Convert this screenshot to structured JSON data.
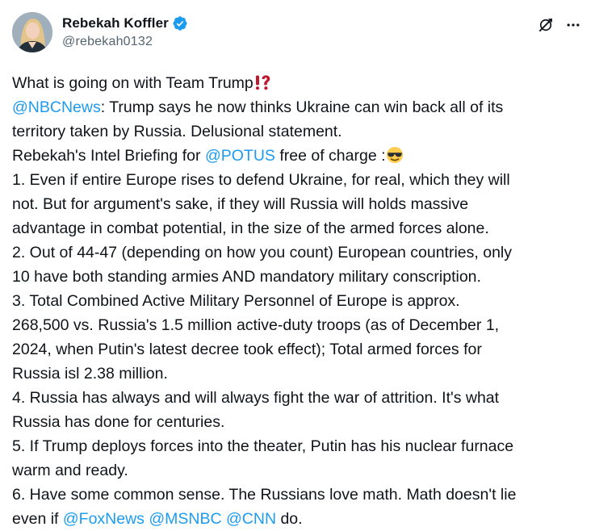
{
  "author": {
    "display_name": "Rebekah Koffler",
    "handle": "@rebekah0132",
    "verified": true
  },
  "icons": {
    "verified": "verified-badge-icon",
    "grok": "grok-icon",
    "more": "more-options-icon",
    "exclamation": "exclamation-question-mark-emoji",
    "sunglasses": "smiling-face-with-sunglasses-emoji"
  },
  "colors": {
    "link": "#1d9bf0",
    "text": "#0f1419",
    "secondary": "#536471"
  },
  "tweet": {
    "l1": "What is going on with Team Trump",
    "l2_mention": "@NBCNews",
    "l2_text": ": Trump says he now thinks Ukraine can win back all of its",
    "l3": "territory taken by Russia. Delusional statement.",
    "l4_pre": "Rebekah's Intel Briefing for ",
    "l4_mention": "@POTUS",
    "l4_post": " free of charge :",
    "l5": "1. Even if entire Europe rises to defend Ukraine, for real, which they will",
    "l6": "not. But for argument's sake, if they will Russia will holds massive",
    "l7": "advantage in combat potential, in the size of the armed forces alone.",
    "l8": "2. Out of 44-47 (depending on how you count) European countries, only",
    "l9": "10 have both standing armies AND mandatory military conscription.",
    "l10": "3. Total Combined Active Military Personnel of Europe is approx.",
    "l11": "268,500 vs. Russia's 1.5 million active-duty troops (as of December 1,",
    "l12": "2024, when Putin's latest decree took effect); Total armed forces for",
    "l13": "Russia isl 2.38 million.",
    "l14": "4. Russia has always and will always fight the war of attrition. It's what",
    "l15": "Russia has done for centuries.",
    "l16": "5. If Trump deploys forces into the theater, Putin has his nuclear furnace",
    "l17": "warm and ready.",
    "l18": "6. Have some common sense. The Russians love math. Math doesn't lie",
    "l19_pre": "even if ",
    "l19_m1": "@FoxNews",
    "l19_m2": "@MSNBC",
    "l19_m3": "@CNN",
    "l19_post": " do.",
    "space": " "
  }
}
